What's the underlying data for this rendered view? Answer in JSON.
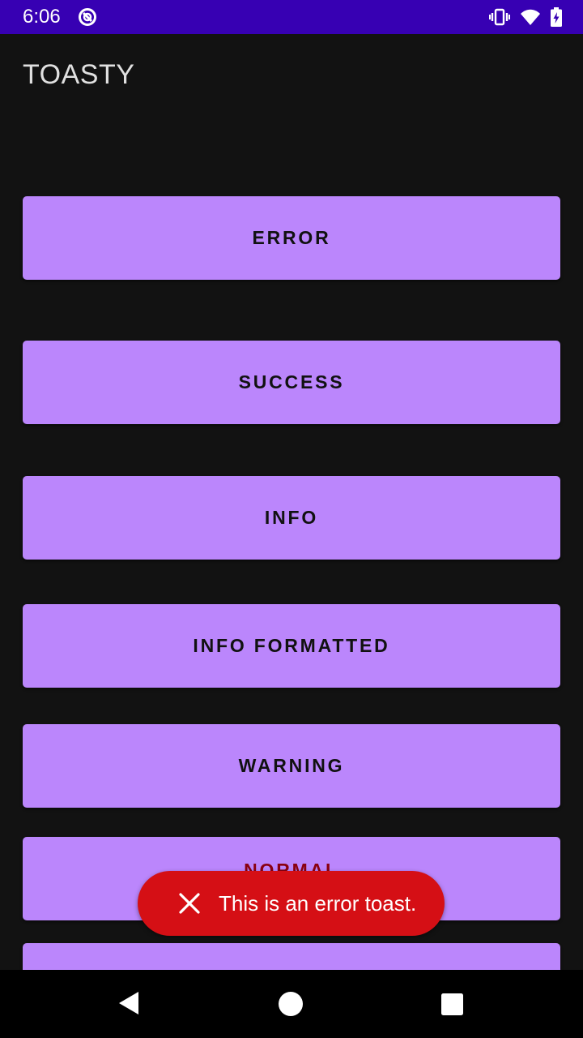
{
  "status_bar": {
    "time": "6:06",
    "icons": [
      "app-notification-icon",
      "vibrate-icon",
      "wifi-icon",
      "battery-charging-icon"
    ]
  },
  "app_bar": {
    "title": "TOASTY"
  },
  "buttons": [
    {
      "label": "ERROR"
    },
    {
      "label": "SUCCESS"
    },
    {
      "label": "INFO"
    },
    {
      "label": "INFO FORMATTED"
    },
    {
      "label": "WARNING"
    },
    {
      "label": "NORMAL"
    }
  ],
  "toast": {
    "icon": "close-icon",
    "message": "This is an error toast."
  },
  "nav_bar": {
    "icons": [
      "back-icon",
      "home-icon",
      "recents-icon"
    ]
  },
  "colors": {
    "status_bar": "#3700B3",
    "background": "#121212",
    "button": "#BB86FC",
    "toast": "#D50F15"
  }
}
